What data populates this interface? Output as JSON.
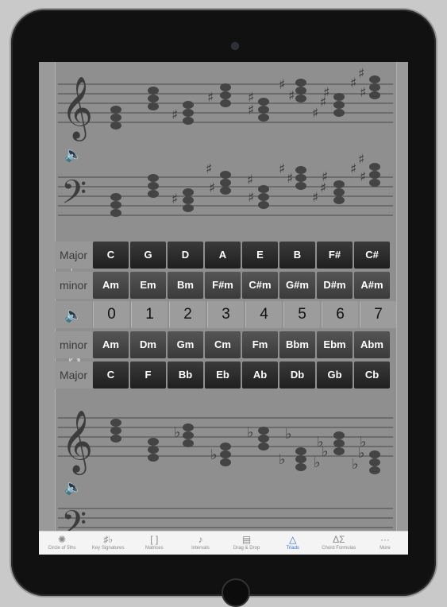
{
  "table": {
    "sharp_major_label": "Major",
    "sharp_minor_label": "minor",
    "flat_minor_label": "minor",
    "flat_major_label": "Major",
    "sharp_major": [
      "C",
      "G",
      "D",
      "A",
      "E",
      "B",
      "F#",
      "C#"
    ],
    "sharp_minor": [
      "Am",
      "Em",
      "Bm",
      "F#m",
      "C#m",
      "G#m",
      "D#m",
      "A#m"
    ],
    "accidental_counts": [
      "0",
      "1",
      "2",
      "3",
      "4",
      "5",
      "6",
      "7"
    ],
    "flat_minor": [
      "Am",
      "Dm",
      "Gm",
      "Cm",
      "Fm",
      "Bbm",
      "Ebm",
      "Abm"
    ],
    "flat_major": [
      "C",
      "F",
      "Bb",
      "Eb",
      "Ab",
      "Db",
      "Gb",
      "Cb"
    ],
    "sharp_symbol": "♯",
    "flat_symbol": "♭"
  },
  "icons": {
    "speaker": "speaker-icon",
    "treble_clef": "𝄞",
    "bass_clef": "𝄢"
  },
  "tabs": [
    {
      "label": "Circle of 5ths",
      "icon": "✺"
    },
    {
      "label": "Key Signatures",
      "icon": "♯♭"
    },
    {
      "label": "Matrices",
      "icon": "[ ]"
    },
    {
      "label": "Intervals",
      "icon": "♪"
    },
    {
      "label": "Drag & Drop",
      "icon": "▤"
    },
    {
      "label": "Triads",
      "icon": "△"
    },
    {
      "label": "Chord Formulas",
      "icon": "ΔΣ"
    },
    {
      "label": "More",
      "icon": "···"
    }
  ],
  "active_tab": "Triads",
  "colors": {
    "active_tab": "#2f6fe0",
    "cell_dark": "#2a2a2a"
  }
}
